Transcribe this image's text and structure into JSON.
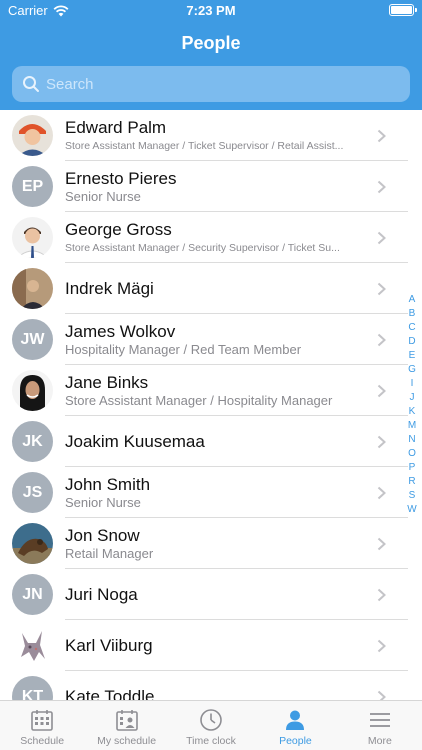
{
  "status": {
    "carrier": "Carrier",
    "time": "7:23 PM"
  },
  "header": {
    "title": "People"
  },
  "search": {
    "placeholder": "Search"
  },
  "people": [
    {
      "name": "Edward Palm",
      "subtitle": "Store Assistant Manager / Ticket Supervisor / Retail Assist...",
      "avatar": "photo"
    },
    {
      "name": "Ernesto Pieres",
      "subtitle": "Senior Nurse",
      "initials": "EP"
    },
    {
      "name": "George Gross",
      "subtitle": "Store Assistant Manager / Security Supervisor / Ticket Su...",
      "avatar": "photo"
    },
    {
      "name": "Indrek Mägi",
      "subtitle": "",
      "avatar": "photo"
    },
    {
      "name": "James Wolkov",
      "subtitle": "Hospitality Manager / Red Team Member",
      "initials": "JW"
    },
    {
      "name": "Jane Binks",
      "subtitle": "Store Assistant Manager / Hospitality Manager",
      "avatar": "photo"
    },
    {
      "name": "Joakim Kuusemaa",
      "subtitle": "",
      "initials": "JK"
    },
    {
      "name": "John Smith",
      "subtitle": "Senior Nurse",
      "initials": "JS"
    },
    {
      "name": "Jon Snow",
      "subtitle": "Retail Manager",
      "avatar": "photo"
    },
    {
      "name": "Juri Noga",
      "subtitle": "",
      "initials": "JN"
    },
    {
      "name": "Karl Viiburg",
      "subtitle": "",
      "avatar": "photo"
    },
    {
      "name": "Kate Toddle",
      "subtitle": "",
      "initials": "KT"
    }
  ],
  "index_letters": [
    "A",
    "B",
    "C",
    "D",
    "E",
    "G",
    "I",
    "J",
    "K",
    "M",
    "N",
    "O",
    "P",
    "R",
    "S",
    "W"
  ],
  "tabs": [
    {
      "label": "Schedule",
      "icon": "calendar-icon",
      "active": false
    },
    {
      "label": "My schedule",
      "icon": "person-calendar-icon",
      "active": false
    },
    {
      "label": "Time clock",
      "icon": "clock-icon",
      "active": false
    },
    {
      "label": "People",
      "icon": "person-icon",
      "active": true
    },
    {
      "label": "More",
      "icon": "menu-icon",
      "active": false
    }
  ],
  "colors": {
    "accent": "#3e9be3",
    "initials_bg": "#a7b0ba"
  }
}
